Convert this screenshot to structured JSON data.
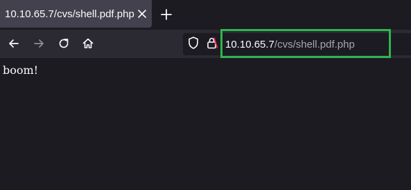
{
  "tab": {
    "title": "10.10.65.7/cvs/shell.pdf.php",
    "close_icon": "close-icon"
  },
  "toolbar": {
    "new_tab_icon": "plus-icon",
    "back_icon": "arrow-left-icon",
    "forward_icon": "arrow-right-icon",
    "reload_icon": "reload-icon",
    "home_icon": "home-icon"
  },
  "urlbar": {
    "host": "10.10.65.7",
    "path": "/cvs/shell.pdf.php",
    "shield_icon": "shield-icon",
    "lock_icon": "insecure-lock-icon"
  },
  "page": {
    "text": "boom!"
  },
  "colors": {
    "highlight_border": "#2fb64b",
    "background": "#1c1b22",
    "toolbar": "#2b2a33",
    "tab": "#42414d"
  }
}
